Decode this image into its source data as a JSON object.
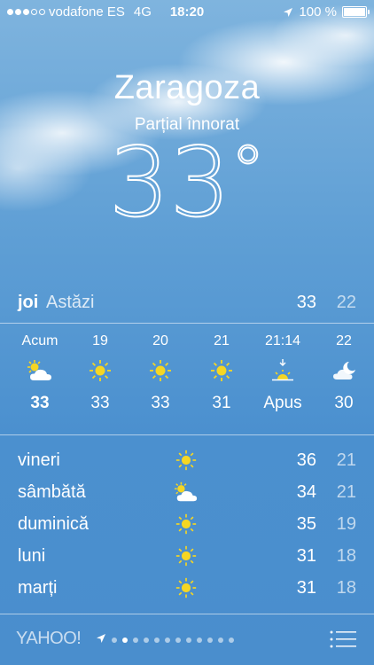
{
  "status_bar": {
    "carrier": "vodafone ES",
    "network": "4G",
    "time": "18:20",
    "battery": "100 %",
    "battery_level": 1.0,
    "signal_bars": 3,
    "signal_total": 5
  },
  "location": {
    "city": "Zaragoza",
    "condition": "Parțial înnorat",
    "temperature": "33",
    "degree_symbol": "°"
  },
  "today": {
    "day": "joi",
    "label": "Astăzi",
    "high": "33",
    "low": "22"
  },
  "hourly": [
    {
      "time": "Acum",
      "icon": "partly-cloudy-icon",
      "value": "33"
    },
    {
      "time": "19",
      "icon": "sun-icon",
      "value": "33"
    },
    {
      "time": "20",
      "icon": "sun-icon",
      "value": "33"
    },
    {
      "time": "21",
      "icon": "sun-icon",
      "value": "31"
    },
    {
      "time": "21:14",
      "icon": "sunset-icon",
      "value": "Apus"
    },
    {
      "time": "22",
      "icon": "moon-cloud-icon",
      "value": "30"
    }
  ],
  "daily": [
    {
      "day": "vineri",
      "icon": "sun-icon",
      "high": "36",
      "low": "21"
    },
    {
      "day": "sâmbătă",
      "icon": "partly-cloudy-icon",
      "high": "34",
      "low": "21"
    },
    {
      "day": "duminică",
      "icon": "sun-icon",
      "high": "35",
      "low": "19"
    },
    {
      "day": "luni",
      "icon": "sun-icon",
      "high": "31",
      "low": "18"
    },
    {
      "day": "marți",
      "icon": "sun-icon",
      "high": "31",
      "low": "18"
    }
  ],
  "bottom_bar": {
    "brand": "YAHOO!",
    "page_count": 12,
    "active_page": 1
  },
  "colors": {
    "sun": "#f5d623",
    "background": "#4b90cf"
  }
}
